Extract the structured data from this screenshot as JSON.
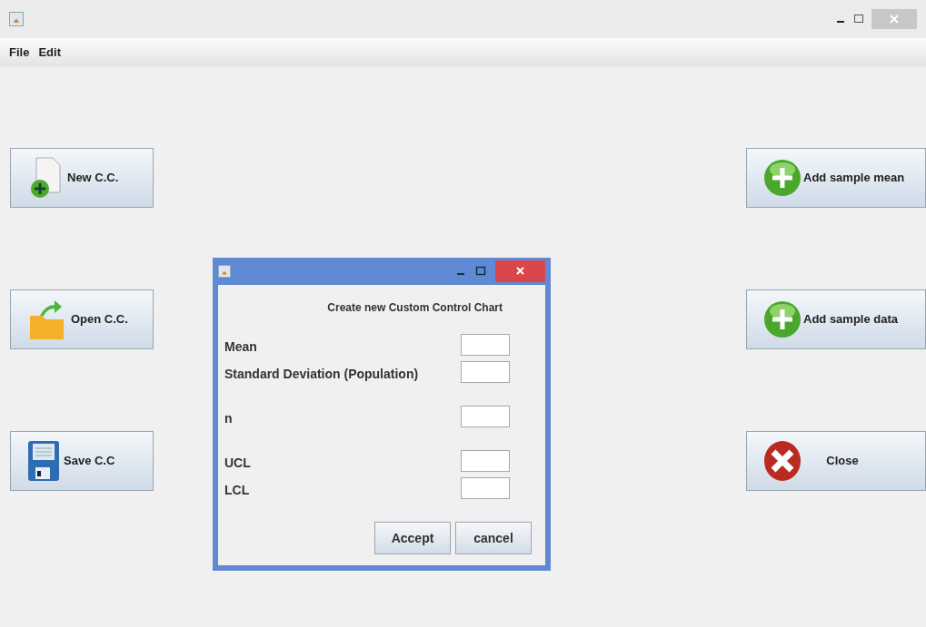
{
  "menu": [
    "File",
    "Edit"
  ],
  "left_buttons": [
    {
      "label": "New C.C.",
      "kind": "new"
    },
    {
      "label": "Open C.C.",
      "kind": "open"
    },
    {
      "label": "Save C.C",
      "kind": "save"
    }
  ],
  "right_buttons": [
    {
      "label": "Add sample mean",
      "kind": "add"
    },
    {
      "label": "Add sample data",
      "kind": "add"
    },
    {
      "label": "Close",
      "kind": "close"
    }
  ],
  "dialog": {
    "heading": "Create new Custom Control Chart",
    "field_groups": [
      [
        {
          "label": "Mean"
        },
        {
          "label": "Standard Deviation (Population)"
        }
      ],
      [
        {
          "label": "n"
        }
      ],
      [
        {
          "label": "UCL"
        },
        {
          "label": "LCL"
        }
      ]
    ],
    "buttons": [
      "Accept",
      "cancel"
    ]
  }
}
